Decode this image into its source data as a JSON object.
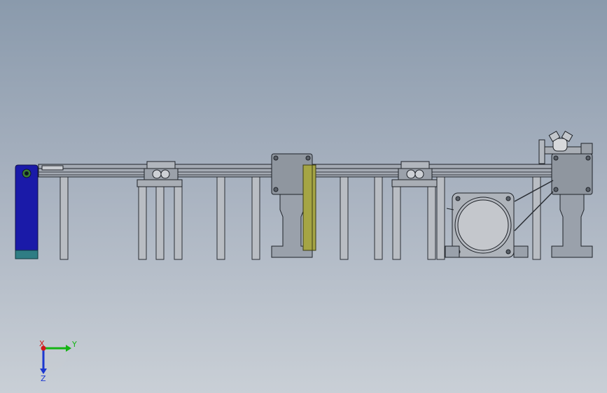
{
  "triad": {
    "x_label": "X",
    "y_label": "Y",
    "z_label": "Z"
  },
  "colors": {
    "background_top": "#8a9aac",
    "background_bottom": "#c9cfd6",
    "metal": "#9aa1ab",
    "metal_light": "#c3c7cd",
    "metal_dark": "#6f7680",
    "outline": "#1e2228",
    "blue_bracket": "#1a1aa8",
    "teal_base": "#2f7d84",
    "olive_plate": "#a5a544",
    "x_axis": "#d01818",
    "y_axis": "#14b414",
    "z_axis": "#1c38d0"
  }
}
